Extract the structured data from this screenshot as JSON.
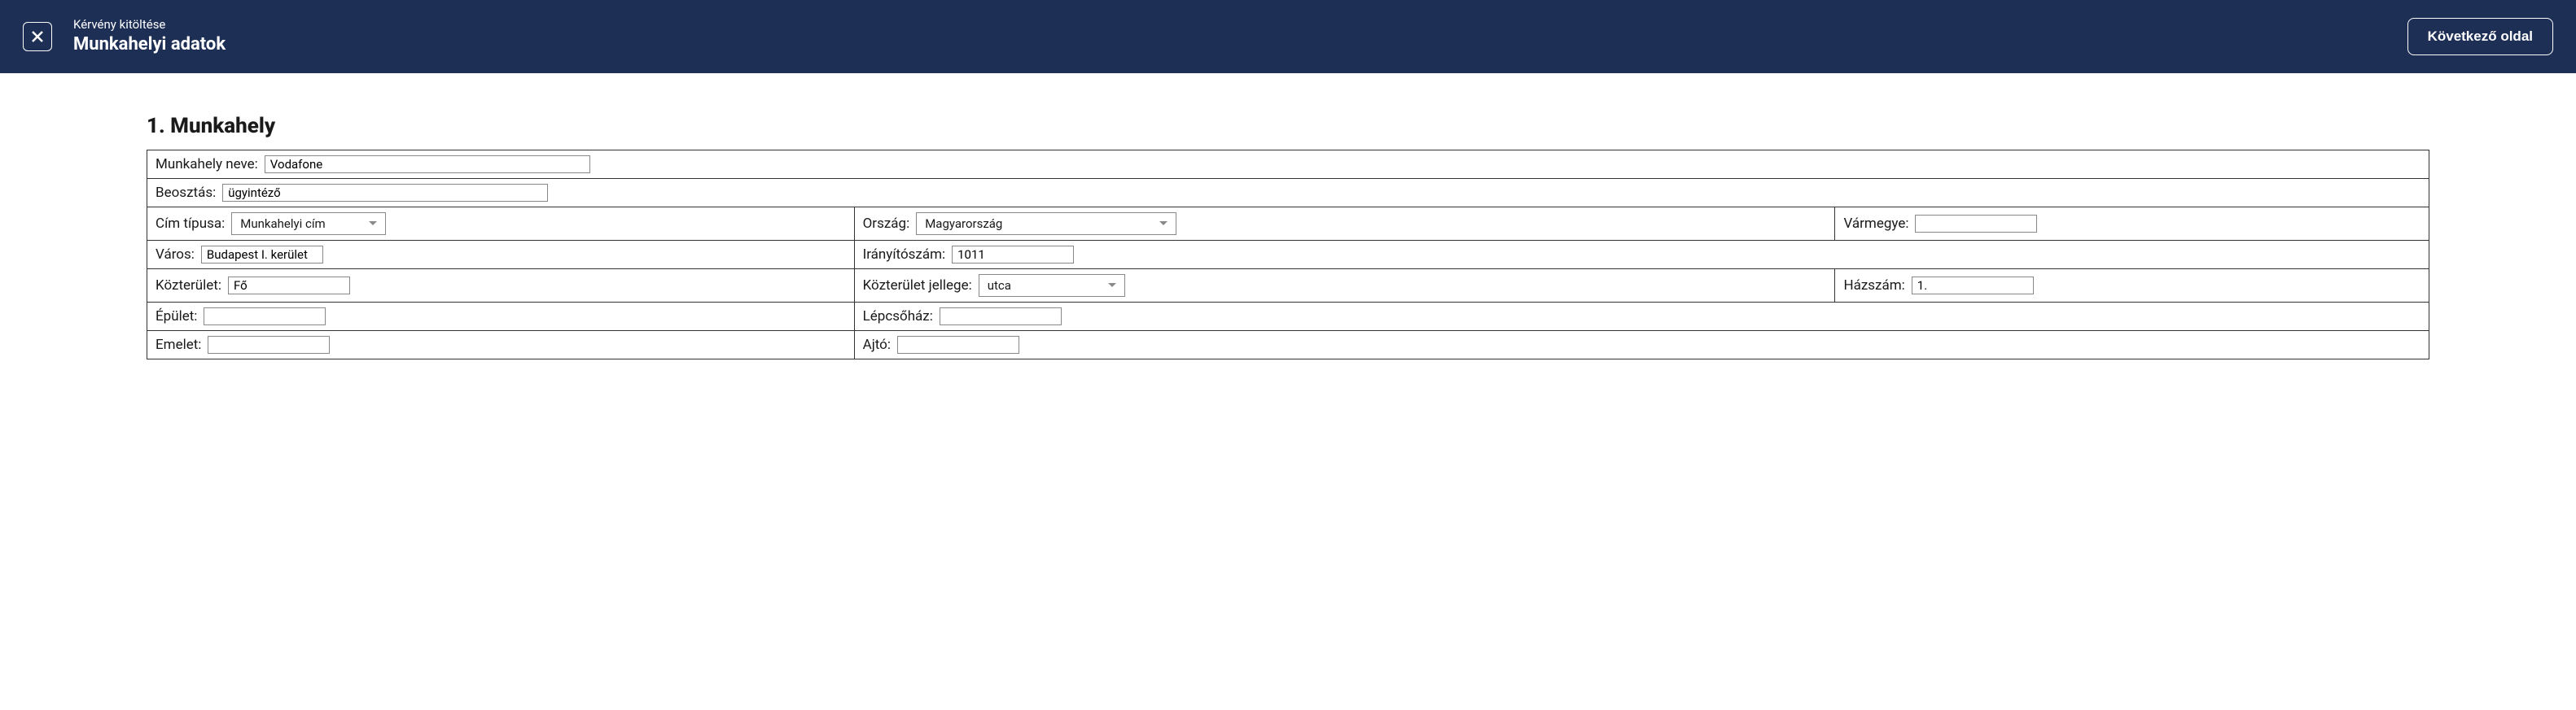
{
  "header": {
    "subtitle": "Kérvény kitöltése",
    "title": "Munkahelyi adatok",
    "next_button": "Következő oldal"
  },
  "section": {
    "title": "1. Munkahely"
  },
  "form": {
    "workplace_name_label": "Munkahely neve:",
    "workplace_name_value": "Vodafone",
    "position_label": "Beosztás:",
    "position_value": "ügyintéző",
    "address_type_label": "Cím típusa:",
    "address_type_value": "Munkahelyi cím",
    "country_label": "Ország:",
    "country_value": "Magyarország",
    "county_label": "Vármegye:",
    "county_value": "",
    "city_label": "Város:",
    "city_value": "Budapest I. kerület",
    "postal_code_label": "Irányítószám:",
    "postal_code_value": "1011",
    "street_label": "Közterület:",
    "street_value": "Fő",
    "street_type_label": "Közterület jellege:",
    "street_type_value": "utca",
    "house_number_label": "Házszám:",
    "house_number_value": "1.",
    "building_label": "Épület:",
    "building_value": "",
    "staircase_label": "Lépcsőház:",
    "staircase_value": "",
    "floor_label": "Emelet:",
    "floor_value": "",
    "door_label": "Ajtó:",
    "door_value": ""
  }
}
